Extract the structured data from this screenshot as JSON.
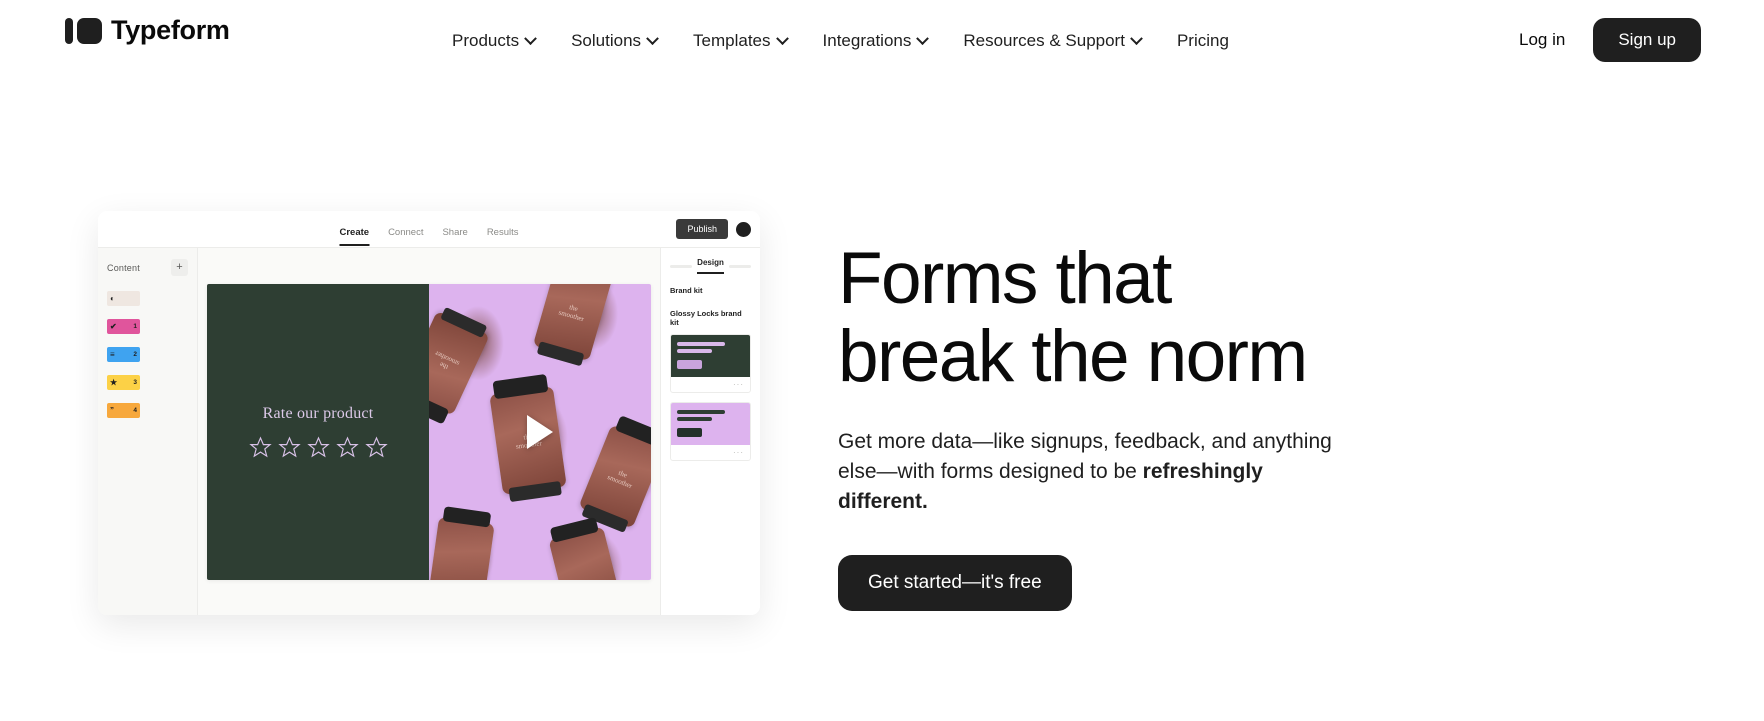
{
  "nav": {
    "brand": "Typeform",
    "links": [
      {
        "label": "Products",
        "has_caret": true
      },
      {
        "label": "Solutions",
        "has_caret": true
      },
      {
        "label": "Templates",
        "has_caret": true
      },
      {
        "label": "Integrations",
        "has_caret": true
      },
      {
        "label": "Resources & Support",
        "has_caret": true
      },
      {
        "label": "Pricing",
        "has_caret": false
      }
    ],
    "login": "Log in",
    "signup": "Sign up"
  },
  "hero": {
    "headline_line1": "Forms that",
    "headline_line2": "break the norm",
    "subtitle_normal": "Get more data—like signups, feedback, and anything else—with forms designed to be ",
    "subtitle_bold": "refreshingly different.",
    "cta": "Get started—it's free"
  },
  "mockup": {
    "tabs": [
      {
        "label": "Create",
        "active": true
      },
      {
        "label": "Connect",
        "active": false
      },
      {
        "label": "Share",
        "active": false
      },
      {
        "label": "Results",
        "active": false
      }
    ],
    "publish": "Publish",
    "rail": {
      "title": "Content",
      "add_label": "+",
      "items": [
        {
          "number": "",
          "glyph": "◐",
          "color": "#efe7e1"
        },
        {
          "number": "1",
          "glyph": "✔",
          "color": "#e0559c"
        },
        {
          "number": "2",
          "glyph": "≡",
          "color": "#3fa3f0"
        },
        {
          "number": "3",
          "glyph": "★",
          "color": "#fcd146"
        },
        {
          "number": "4",
          "glyph": "”",
          "color": "#f7a83c"
        }
      ]
    },
    "card": {
      "question": "Rate our product",
      "star_count": 5,
      "bottle_label": "the\nsmoother",
      "bg_dark": "#2e3e33",
      "bg_lilac": "#ddb3ee"
    },
    "panel": {
      "tab": "Design",
      "section_label": "Brand kit",
      "kit_name": "Glossy Locks brand kit",
      "themes": [
        {
          "style": "dark",
          "menu": "···"
        },
        {
          "style": "lilac",
          "menu": "···"
        }
      ]
    }
  }
}
